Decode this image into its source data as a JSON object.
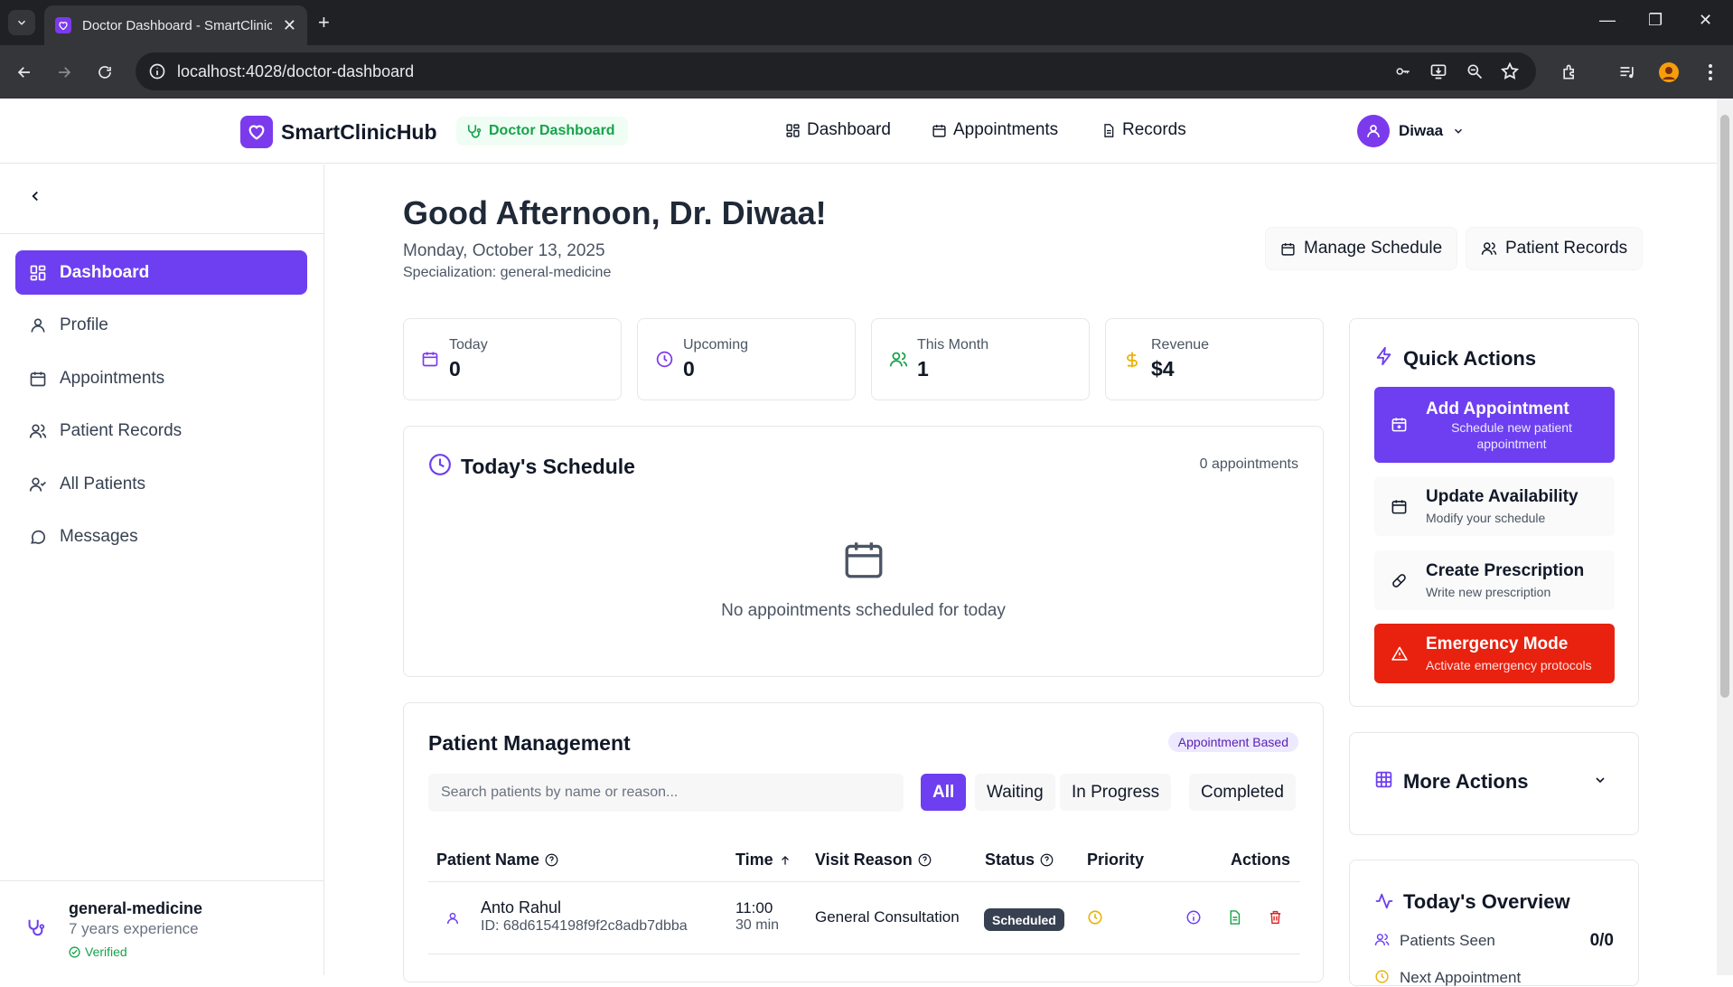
{
  "browser": {
    "tab_title": "Doctor Dashboard - SmartClinicHub",
    "url": "localhost:4028/doctor-dashboard"
  },
  "header": {
    "brand": "SmartClinicHub",
    "role_badge": "Doctor Dashboard",
    "nav": [
      "Dashboard",
      "Appointments",
      "Records"
    ],
    "user_name": "Diwaa"
  },
  "sidebar": {
    "items": [
      {
        "label": "Dashboard",
        "icon": "grid-icon",
        "active": true
      },
      {
        "label": "Profile",
        "icon": "user-icon"
      },
      {
        "label": "Appointments",
        "icon": "calendar-icon"
      },
      {
        "label": "Patient Records",
        "icon": "users-icon"
      },
      {
        "label": "All Patients",
        "icon": "user-check-icon"
      },
      {
        "label": "Messages",
        "icon": "message-icon"
      }
    ],
    "footer": {
      "specialization": "general-medicine",
      "experience": "7 years experience",
      "verified": "Verified"
    }
  },
  "main": {
    "greeting": "Good Afternoon, Dr. Diwaa!",
    "date": "Monday, October 13, 2025",
    "specialization": "Specialization: general-medicine",
    "header_buttons": [
      "Manage Schedule",
      "Patient Records"
    ],
    "stats": [
      {
        "label": "Today",
        "value": "0",
        "color": "#7c3aed"
      },
      {
        "label": "Upcoming",
        "value": "0",
        "color": "#7c3aed"
      },
      {
        "label": "This Month",
        "value": "1",
        "color": "#16a34a"
      },
      {
        "label": "Revenue",
        "value": "$4",
        "color": "#eab308"
      }
    ],
    "schedule": {
      "title": "Today's Schedule",
      "count": "0 appointments",
      "empty": "No appointments scheduled for today"
    },
    "patients": {
      "title": "Patient Management",
      "badge": "Appointment Based",
      "search_placeholder": "Search patients by name or reason...",
      "filters": [
        "All",
        "Waiting",
        "In Progress",
        "Completed"
      ],
      "columns": [
        "Patient Name",
        "Time",
        "Visit Reason",
        "Status",
        "Priority",
        "Actions"
      ],
      "rows": [
        {
          "name": "Anto Rahul",
          "id": "ID: 68d6154198f9f2c8adb7dbba",
          "time": "11:00",
          "duration": "30 min",
          "reason": "General Consultation",
          "status": "Scheduled"
        }
      ]
    }
  },
  "right": {
    "quick_actions": {
      "title": "Quick Actions",
      "items": [
        {
          "title": "Add Appointment",
          "subtitle": "Schedule new patient appointment"
        },
        {
          "title": "Update Availability",
          "subtitle": "Modify your schedule"
        },
        {
          "title": "Create Prescription",
          "subtitle": "Write new prescription"
        },
        {
          "title": "Emergency Mode",
          "subtitle": "Activate emergency protocols"
        }
      ]
    },
    "more_actions": "More Actions",
    "overview": {
      "title": "Today's Overview",
      "patients_seen_label": "Patients Seen",
      "patients_seen_value": "0/0",
      "next_label": "Next Appointment"
    }
  },
  "colors": {
    "primary": "#6d3ff0",
    "danger": "#e8220f",
    "success": "#16a34a"
  }
}
